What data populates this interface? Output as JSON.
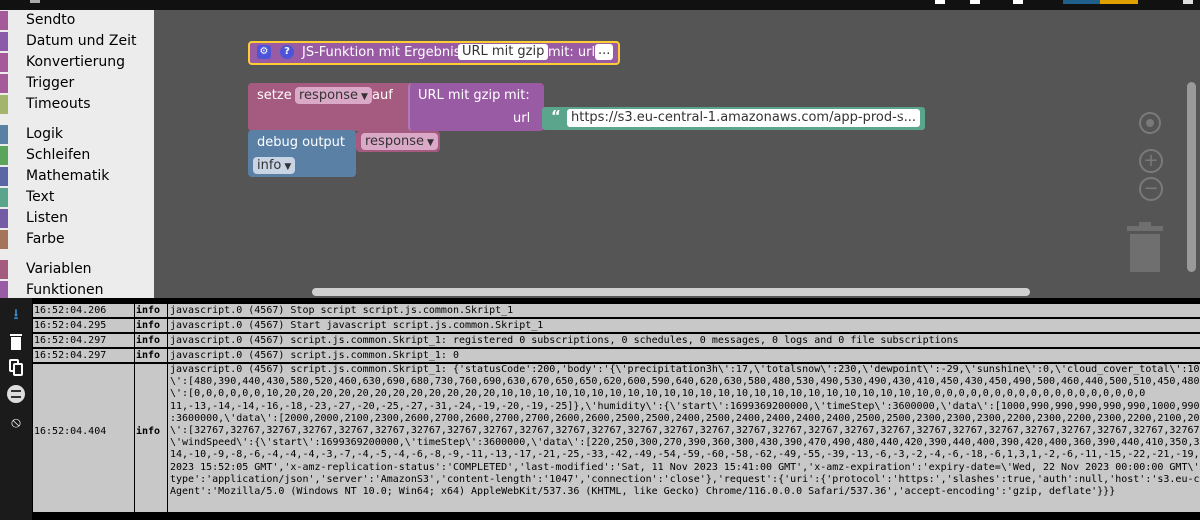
{
  "toolbox": {
    "categories": [
      {
        "label": "Sendto",
        "color": "#a55b9a"
      },
      {
        "label": "Datum und Zeit",
        "color": "#8b5aa8"
      },
      {
        "label": "Konvertierung",
        "color": "#a55b9a"
      },
      {
        "label": "Trigger",
        "color": "#a55b9a"
      },
      {
        "label": "Timeouts",
        "color": "#a2b56b"
      },
      {
        "label": "Logik",
        "color": "#5b80a5"
      },
      {
        "label": "Schleifen",
        "color": "#5ba55b"
      },
      {
        "label": "Mathematik",
        "color": "#5b67a5"
      },
      {
        "label": "Text",
        "color": "#5ba58c"
      },
      {
        "label": "Listen",
        "color": "#745ba5"
      },
      {
        "label": "Farbe",
        "color": "#a5745b"
      },
      {
        "label": "Variablen",
        "color": "#a55b80"
      },
      {
        "label": "Funktionen",
        "color": "#995ba5"
      }
    ]
  },
  "workspace": {
    "function_block": {
      "label": "JS-Funktion mit Ergebnis",
      "name": "URL mit gzip",
      "param_label": "mit: url",
      "more": "..."
    },
    "set_block": {
      "label": "setze",
      "variable": "response",
      "suffix": "auf"
    },
    "call_block": {
      "label": "URL mit gzip",
      "with_label": "mit:",
      "param": "url"
    },
    "text_block": {
      "open_quote": "“",
      "value": "https://s3.eu-central-1.amazonaws.com/app-prod-s...",
      "close_quote": "”"
    },
    "debug_block": {
      "label": "debug output",
      "variable": "response",
      "level": "info"
    }
  },
  "log": {
    "rows": [
      {
        "time": "16:52:04.206",
        "level": "info",
        "message": "javascript.0 (4567) Stop script script.js.common.Skript_1"
      },
      {
        "time": "16:52:04.295",
        "level": "info",
        "message": "javascript.0 (4567) Start javascript script.js.common.Skript_1"
      },
      {
        "time": "16:52:04.297",
        "level": "info",
        "message": "javascript.0 (4567) script.js.common.Skript_1: registered 0 subscriptions, 0 schedules, 0 messages, 0 logs and 0 file subscriptions"
      },
      {
        "time": "16:52:04.297",
        "level": "info",
        "message": "javascript.0 (4567) script.js.common.Skript_1: 0"
      },
      {
        "time": "16:52:04.404",
        "level": "info",
        "message": "javascript.0 (4567) script.js.common.Skript_1: {'statusCode':200,'body':'{\\'precipitation3h\\':17,\\'totalsnow\\':230,\\'dewpoint\\':-29,\\'sunshine\\':0,\\'cloud_cover_total\\':100,\\\n\\':[480,390,440,430,580,520,460,630,690,680,730,760,690,630,670,650,650,620,600,590,640,620,630,580,480,530,490,530,490,430,410,450,430,450,490,500,460,440,500,510,450,480,440\n\\':[0,0,0,0,0,0,10,20,20,20,20,20,20,20,20,20,20,20,20,10,10,10,10,10,10,10,10,10,10,10,10,10,10,10,10,10,10,10,10,10,10,10,10,0,0,0,0,0,0,0,0,0,0,0,0,0,0,0,0,0,0\n11,-13,-14,-14,-16,-18,-23,-27,-20,-25,-27,-31,-24,-19,-20,-19,-25]},\\'humidity\\':{\\'start\\':1699369200000,\\'timeStep\\':3600000,\\'data\\':[1000,990,990,990,990,990,1000,990,990\n:3600000,\\'data\\':[2000,2000,2100,2300,2600,2700,2600,2700,2700,2600,2600,2500,2500,2400,2500,2400,2400,2400,2400,2500,2500,2300,2300,2300,2200,2300,2200,2300,2200,2100,2000\n\\':[32767,32767,32767,32767,32767,32767,32767,32767,32767,32767,32767,32767,32767,32767,32767,32767,32767,32767,32767,32767,32767,32767,32767,32767,32767,32767,32767,32767,327\n\\'windSpeed\\':{\\'start\\':1699369200000,\\'timeStep\\':3600000,\\'data\\':[220,250,300,270,390,360,300,430,390,470,490,480,440,420,390,440,400,390,420,400,360,390,440,410,350,360,3\n14,-10,-9,-8,-6,-4,-4,-4,-3,-7,-4,-5,-4,-6,-8,-9,-11,-13,-17,-21,-25,-33,-42,-49,-54,-59,-60,-58,-62,-49,-55,-39,-13,-6,-3,-2,-4,-6,-18,-6,1,3,1,-2,-6,-11,-15,-22,-21,-19,-14,\n2023 15:52:05 GMT','x-amz-replication-status':'COMPLETED','last-modified':'Sat, 11 Nov 2023 15:41:00 GMT','x-amz-expiration':'expiry-date=\\'Wed, 22 Nov 2023 00:00:00 GMT\\', ru\ntype':'application/json','server':'AmazonS3','content-length':'1047','connection':'close'},'request':{'uri':{'protocol':'https:','slashes':true,'auth':null,'host':'s3.eu-central\nAgent':'Mozilla/5.0 (Windows NT 10.0; Win64; x64) AppleWebKit/537.36 (KHTML, like Gecko) Chrome/116.0.0.0 Safari/537.36','accept-encoding':'gzip, deflate'}}}"
      }
    ]
  },
  "colors": {
    "procedure": "#9a5ba5",
    "variables": "#a55b80",
    "text": "#5ba58c",
    "debug": "#5b80a5",
    "workspace_bg": "#555555",
    "selection": "#fc3"
  }
}
